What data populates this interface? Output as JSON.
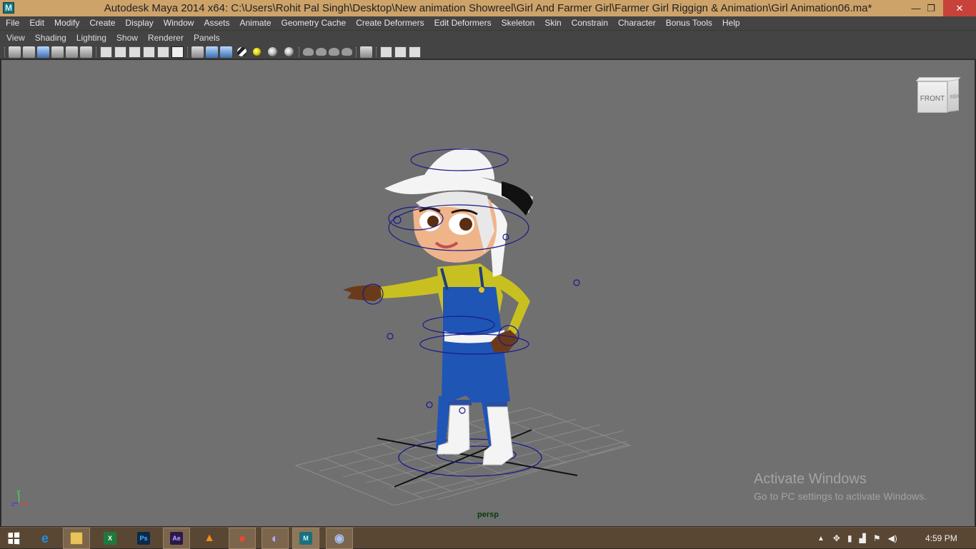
{
  "window": {
    "title": "Autodesk Maya 2014 x64: C:\\Users\\Rohit Pal Singh\\Desktop\\New animation Showreel\\Girl And Farmer Girl\\Farmer Girl Riggign & Animation\\Girl Animation06.ma*",
    "minimize_glyph": "—",
    "maximize_glyph": "❐",
    "close_glyph": "✕"
  },
  "menubar": {
    "items": [
      "File",
      "Edit",
      "Modify",
      "Create",
      "Display",
      "Window",
      "Assets",
      "Animate",
      "Geometry Cache",
      "Create Deformers",
      "Edit Deformers",
      "Skeleton",
      "Skin",
      "Constrain",
      "Character",
      "Bonus Tools",
      "Help"
    ]
  },
  "panel_menu": {
    "items": [
      "View",
      "Shading",
      "Lighting",
      "Show",
      "Renderer",
      "Panels"
    ]
  },
  "viewport": {
    "camera_label": "persp",
    "viewcube": {
      "front": "FRONT",
      "right": "RIGHT"
    },
    "axis": {
      "x": "x",
      "y": "y",
      "z": "z"
    },
    "colors": {
      "background": "#707070",
      "shirt": "#c8c020",
      "overalls": "#1f55b5",
      "skin": "#f0b48a",
      "hat": "#f4f4f4",
      "controls": "#1a1a8c"
    }
  },
  "watermark": {
    "heading": "Activate Windows",
    "subtext": "Go to PC settings to activate Windows."
  },
  "taskbar": {
    "apps": [
      {
        "name": "internet-explorer",
        "glyph": "e",
        "color": "#1f8fe0"
      },
      {
        "name": "file-explorer",
        "glyph": "",
        "color": "#e8c25a"
      },
      {
        "name": "excel",
        "glyph": "X",
        "color": "#1e7a3a"
      },
      {
        "name": "photoshop",
        "glyph": "Ps",
        "color": "#0b2a4a"
      },
      {
        "name": "after-effects",
        "glyph": "Ae",
        "color": "#2a1a4a"
      },
      {
        "name": "vlc",
        "glyph": "▲",
        "color": "#f28c1a"
      },
      {
        "name": "chrome",
        "glyph": "●",
        "color": "#e04b3a"
      },
      {
        "name": "edge-like",
        "glyph": "◐",
        "color": "#7a6ad0"
      },
      {
        "name": "maya",
        "glyph": "M",
        "color": "#1c6f7c"
      },
      {
        "name": "other-app",
        "glyph": "◉",
        "color": "#5a7ab0"
      }
    ],
    "clock": "4:59 PM"
  }
}
